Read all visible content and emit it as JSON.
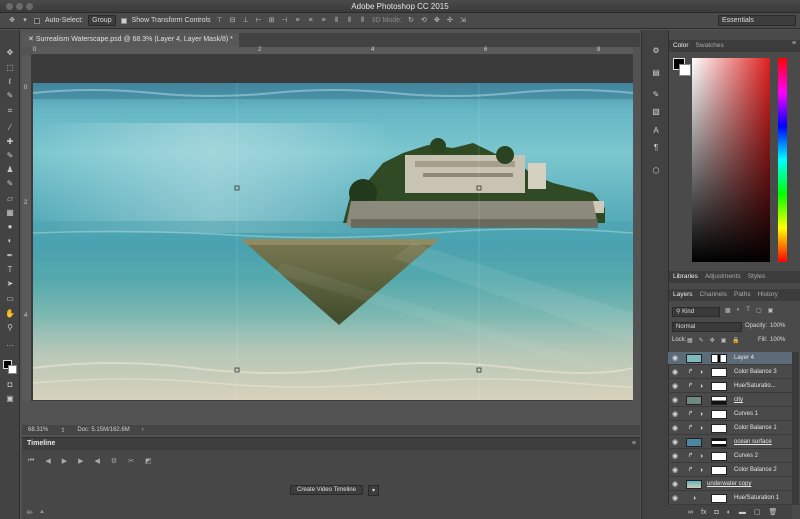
{
  "app": {
    "title": "Adobe Photoshop CC 2015"
  },
  "options_bar": {
    "auto_select_label": "Auto-Select:",
    "auto_select_value": "Group",
    "show_transform_label": "Show Transform Controls",
    "mode_3d_label": "3D Mode:",
    "workspace": "Essentials"
  },
  "document": {
    "tab_title": "Surrealism Waterscape.psd @ 68.3% (Layer 4, Layer Mask/8) *",
    "ruler_top": [
      "0",
      "2",
      "4",
      "6",
      "8"
    ],
    "ruler_left": [
      "0",
      "2",
      "4"
    ],
    "zoom": "68.31%",
    "doc_size": "Doc: 5.15M/162.6M"
  },
  "timeline": {
    "title": "Timeline",
    "create_button": "Create Video Timeline"
  },
  "color_panel": {
    "tabs": [
      "Color",
      "Swatches"
    ],
    "active": "Color"
  },
  "libraries_panel": {
    "tabs": [
      "Libraries",
      "Adjustments",
      "Styles"
    ],
    "active": "Libraries"
  },
  "layers_panel": {
    "tabs": [
      "Layers",
      "Channels",
      "Paths",
      "History"
    ],
    "active": "Layers",
    "filter_kind": "Kind",
    "blend_mode": "Normal",
    "opacity_label": "Opacity:",
    "opacity_value": "100%",
    "lock_label": "Lock:",
    "fill_label": "Fill:",
    "fill_value": "100%",
    "layers": [
      {
        "name": "Layer 4",
        "kind": "pixel-mask",
        "selected": true
      },
      {
        "name": "Color Balance 3",
        "kind": "adjust"
      },
      {
        "name": "Hue/Saturatio...",
        "kind": "adjust"
      },
      {
        "name": "city",
        "kind": "pixel-mask"
      },
      {
        "name": "Curves 1",
        "kind": "adjust"
      },
      {
        "name": "Color Balance 1",
        "kind": "adjust"
      },
      {
        "name": "ocean surface",
        "kind": "pixel-mask"
      },
      {
        "name": "Curves 2",
        "kind": "adjust"
      },
      {
        "name": "Color Balance 2",
        "kind": "adjust"
      },
      {
        "name": "underwater copy",
        "kind": "pixel"
      },
      {
        "name": "Hue/Saturation 1",
        "kind": "adjust"
      }
    ]
  },
  "colors": {
    "accent_selected_layer": "#5d6a78",
    "panel_bg": "#4a4a4a",
    "canvas_bg": "#3b3b3b"
  }
}
